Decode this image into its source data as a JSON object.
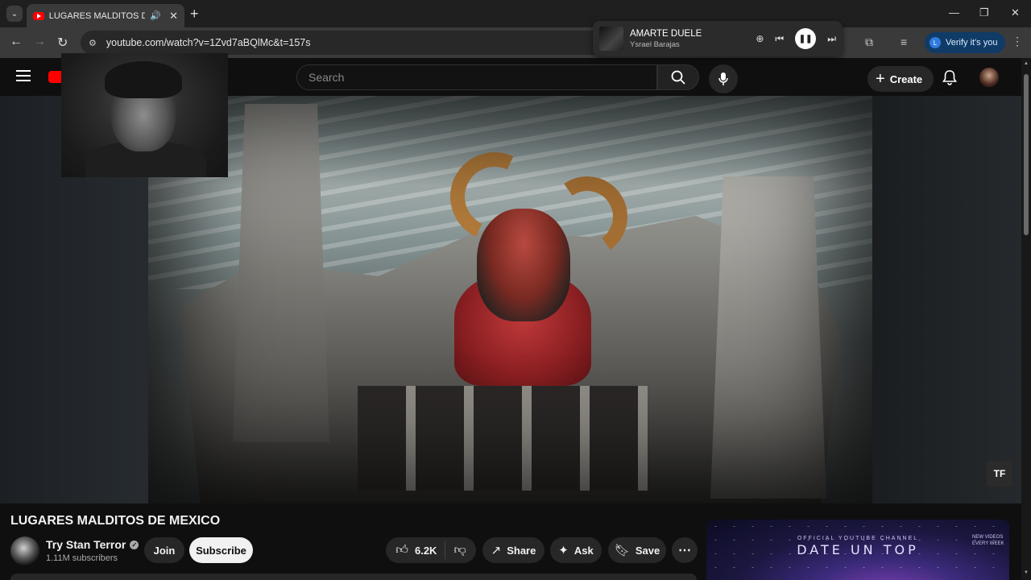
{
  "browser": {
    "tab_title": "LUGARES MALDITOS DE ME",
    "url": "youtube.com/watch?v=1Zvd7aBQlMc&t=157s",
    "verify_label": "Verify it's you",
    "verify_avatar_letter": "L"
  },
  "media_popup": {
    "song": "AMARTE DUELE",
    "artist": "Ysrael Barajas"
  },
  "header": {
    "search_placeholder": "Search",
    "create_label": "Create"
  },
  "video": {
    "overlay_button": "TF",
    "title": "LUGARES MALDITOS DE MEXICO"
  },
  "channel": {
    "name": "Try Stan Terror",
    "subscribers": "1.11M subscribers",
    "join_label": "Join",
    "subscribe_label": "Subscribe"
  },
  "actions": {
    "likes": "6.2K",
    "share": "Share",
    "ask": "Ask",
    "save": "Save"
  },
  "ad": {
    "subtitle": "OFFICIAL YOUTUBE CHANNEL",
    "title": "DATE UN TOP",
    "side_text": "NEW VIDEOS EVERY WEEK"
  },
  "icons": {
    "brand_red": "#ff0000",
    "verify_blue": "#0f3b66"
  }
}
